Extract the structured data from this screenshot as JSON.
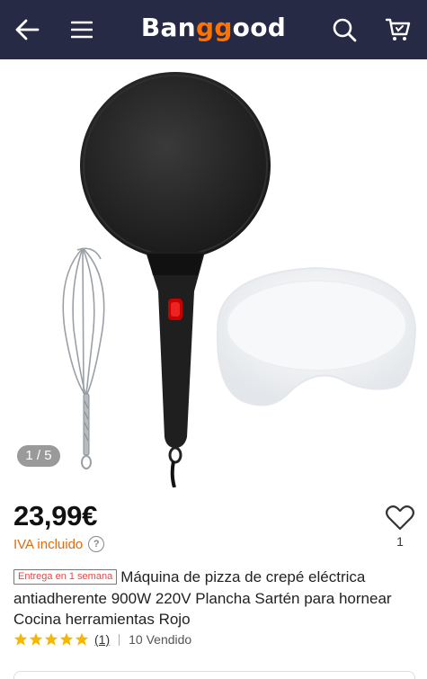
{
  "header": {
    "logo_prefix": "Ban",
    "logo_highlight": "gg",
    "logo_suffix": "ood",
    "icons": [
      "back-arrow-icon",
      "menu-icon",
      "search-icon",
      "cart-icon"
    ],
    "background": "#262a45",
    "accent": "#ff7200"
  },
  "gallery": {
    "counter": "1 / 5"
  },
  "product": {
    "price": "23,99€",
    "vat_label": "IVA incluido",
    "wishlist_count": "1",
    "delivery_badge": "Entrega en 1 semana",
    "title": "Máquina de pizza de crepé eléctrica antiadherente 900W 220V Plancha Sartén para hornear Cocina herramientas  Rojo",
    "rating_stars": 5,
    "reviews": "(1)",
    "sold": "10 Vendido"
  }
}
